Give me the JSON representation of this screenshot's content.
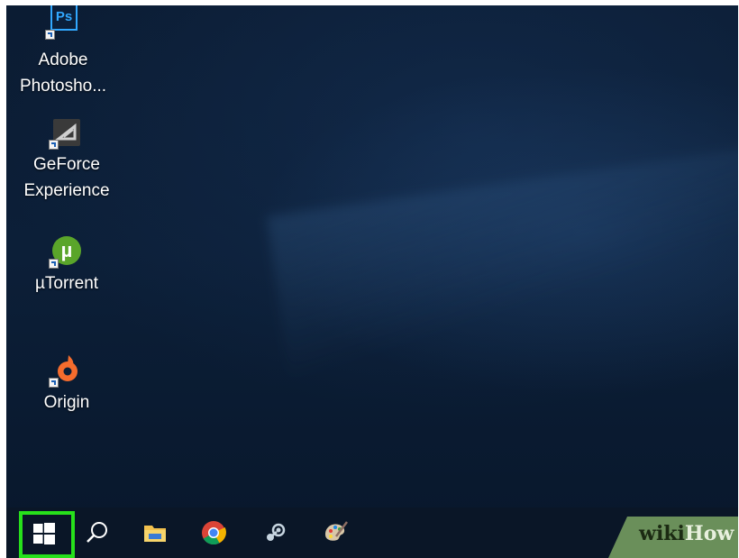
{
  "desktop": {
    "icons": [
      {
        "name": "adobe-photoshop",
        "label_line1": "Adobe",
        "label_line2": "Photosho...",
        "glyph_text": "Ps",
        "color": "#31a8ff"
      },
      {
        "name": "geforce-experience",
        "label_line1": "GeForce",
        "label_line2": "Experience",
        "color": "#76b900"
      },
      {
        "name": "utorrent",
        "label_line1": "µTorrent",
        "glyph_text": "µ",
        "color": "#5aa52a"
      },
      {
        "name": "origin",
        "label_line1": "Origin",
        "color": "#f56c2d"
      }
    ]
  },
  "taskbar": {
    "items": [
      {
        "name": "start-button",
        "icon": "windows-logo-icon"
      },
      {
        "name": "search-button",
        "icon": "search-icon"
      },
      {
        "name": "file-explorer-button",
        "icon": "folder-icon"
      },
      {
        "name": "chrome-button",
        "icon": "chrome-icon"
      },
      {
        "name": "steam-button",
        "icon": "steam-icon"
      },
      {
        "name": "paint-button",
        "icon": "paint-palette-icon"
      }
    ],
    "highlight_color": "#27e11b"
  },
  "watermark": {
    "part1": "wiki",
    "part2": "How"
  }
}
